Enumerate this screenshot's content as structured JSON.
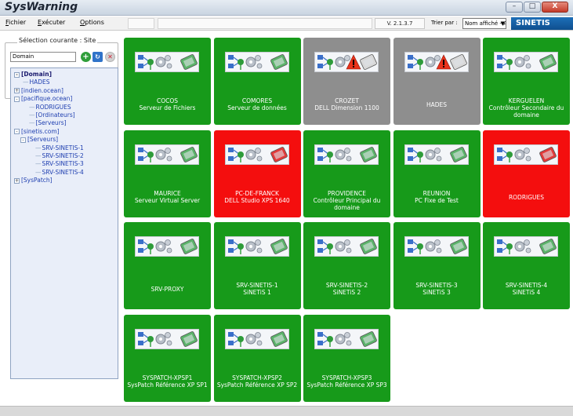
{
  "app": {
    "title": "SysWarning",
    "window_controls": [
      "–",
      "□",
      "X"
    ]
  },
  "menu": {
    "items": [
      {
        "label": "Fichier",
        "underline": "F",
        "rest": "ichier"
      },
      {
        "label": "Exécuter",
        "underline": "E",
        "rest": "xécuter"
      },
      {
        "label": "Options",
        "underline": "O",
        "rest": "ptions"
      }
    ],
    "version": "V. 2.1.3.7",
    "sort_label": "Trier par :",
    "sort_value": "Nom affiché - Asce",
    "brand": "SINETIS"
  },
  "site_selection": {
    "legend": "Sélection courante : Site",
    "input_value": "Domain",
    "buttons": [
      "add-icon",
      "refresh-icon",
      "remove-icon"
    ]
  },
  "tree": [
    {
      "label": "[Domain]",
      "type": "root",
      "expander": "-"
    },
    {
      "label": "HADES",
      "level": 1
    },
    {
      "label": "[indien.ocean]",
      "level": 0,
      "expander": "+"
    },
    {
      "label": "[pacifique.ocean]",
      "level": 0,
      "expander": "-"
    },
    {
      "label": "RODRIGUES",
      "level": 2
    },
    {
      "label": "[Ordinateurs]",
      "level": 2
    },
    {
      "label": "[Serveurs]",
      "level": 2
    },
    {
      "label": "[sinetis.com]",
      "level": 0,
      "expander": "-"
    },
    {
      "label": "[Serveurs]",
      "level": 1,
      "expander": "-"
    },
    {
      "label": "SRV-SINETIS-1",
      "level": 3
    },
    {
      "label": "SRV-SINETIS-2",
      "level": 3
    },
    {
      "label": "SRV-SINETIS-3",
      "level": 3
    },
    {
      "label": "SRV-SINETIS-4",
      "level": 3
    },
    {
      "label": "[SysPatch]",
      "level": 0,
      "expander": "+"
    }
  ],
  "tiles": [
    {
      "name": "COCOS",
      "sub": "Serveur de Fichiers",
      "status": "green"
    },
    {
      "name": "COMORES",
      "sub": "Serveur de données",
      "status": "green"
    },
    {
      "name": "CROZET",
      "sub": "DELL Dimension 1100",
      "status": "grey"
    },
    {
      "name": "HADES",
      "sub": "",
      "status": "grey"
    },
    {
      "name": "KERGUELEN",
      "sub": "Contrôleur Secondaire du domaine",
      "status": "green"
    },
    {
      "name": "MAURICE",
      "sub": "Serveur Virtual Server",
      "status": "green"
    },
    {
      "name": "PC-DE-FRANCK",
      "sub": "DELL Studio XPS 1640",
      "status": "red"
    },
    {
      "name": "PROVIDENCE",
      "sub": "Contrôleur Principal du domaine",
      "status": "green"
    },
    {
      "name": "REUNION",
      "sub": "PC Fixe de Test",
      "status": "green"
    },
    {
      "name": "RODRIGUES",
      "sub": "",
      "status": "red"
    },
    {
      "name": "SRV-PROXY",
      "sub": "",
      "status": "green"
    },
    {
      "name": "SRV-SINETIS-1",
      "sub": "SiNETiS 1",
      "status": "green"
    },
    {
      "name": "SRV-SINETIS-2",
      "sub": "SiNETiS 2",
      "status": "green"
    },
    {
      "name": "SRV-SINETIS-3",
      "sub": "SiNETiS 3",
      "status": "green"
    },
    {
      "name": "SRV-SINETIS-4",
      "sub": "SiNETiS 4",
      "status": "green"
    },
    {
      "name": "SYSPATCH-XPSP1",
      "sub": "SysPatch Référence XP SP1",
      "status": "green"
    },
    {
      "name": "SYSPATCH-XPSP2",
      "sub": "SysPatch Référence XP SP2",
      "status": "green"
    },
    {
      "name": "SYSPATCH-XPSP3",
      "sub": "SysPatch Référence XP SP3",
      "status": "green"
    }
  ],
  "colors": {
    "ok": "#179a1a",
    "offline": "#8e8e8e",
    "alert": "#f40e0e",
    "tree_bg": "#e9eef9"
  }
}
